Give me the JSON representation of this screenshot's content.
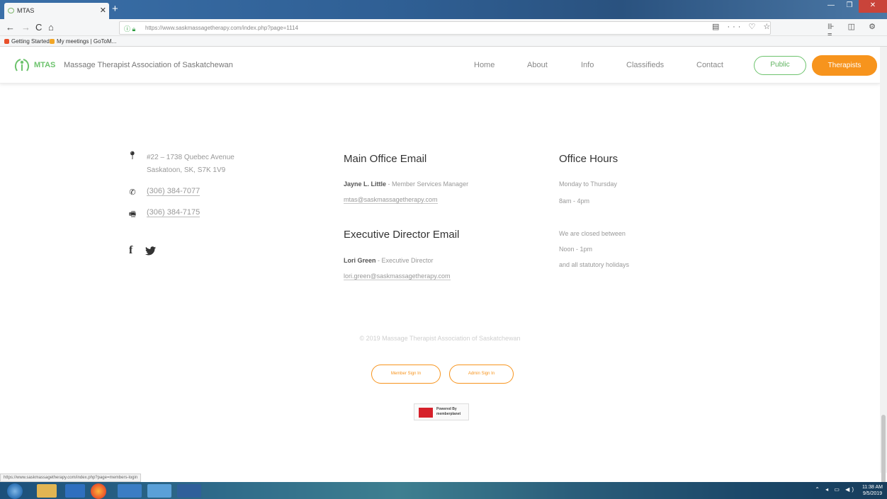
{
  "browser": {
    "tab_title": "MTAS",
    "new_tab_symbol": "+",
    "url": "https://www.saskmassagetherapy.com/index.php?page=1114",
    "nav_back": "←",
    "nav_forward": "→",
    "nav_reload": "C",
    "nav_home": "⌂",
    "page_actions": "▤ ··· ♡ ☆",
    "toolbar_right": "⊪ ◫ ⚙ ≡",
    "bookmarks": [
      "Getting Started",
      "My meetings | GoToM..."
    ],
    "window_controls": [
      "—",
      "❐",
      "✕"
    ]
  },
  "site": {
    "logo_abbr": "MTAS",
    "logo_name": "Massage Therapist Association of Saskatchewan",
    "nav": [
      "Home",
      "About",
      "Info",
      "Classifieds",
      "Contact"
    ],
    "btn_public": "Public",
    "btn_therapists": "Therapists"
  },
  "contact": {
    "address_line1": "#22 – 1738 Quebec Avenue",
    "address_line2": "Saskatoon, SK, S7K 1V9",
    "phone": "(306) 384-7077",
    "fax": "(306) 384-7175"
  },
  "main_office": {
    "heading": "Main Office Email",
    "person_name": "Jayne L. Little",
    "person_role": " - Member Services Manager",
    "email": "mtas@saskmassagetherapy.com"
  },
  "exec_director": {
    "heading": "Executive Director Email",
    "person_name": "Lori Green",
    "person_role": " - Executive Director",
    "email": "lori.green@saskmassagetherapy.com"
  },
  "office_hours": {
    "heading": "Office Hours",
    "days": "Monday to Thursday",
    "hours": "8am - 4pm",
    "closed_line1": "We are closed between",
    "closed_line2": "Noon - 1pm",
    "closed_line3": "and all statutory holidays"
  },
  "footer": {
    "copyright": "© 2019 Massage Therapist Association of Saskatchewan",
    "member_signin": "Member Sign In",
    "admin_signin": "Admin Sign In",
    "powered_line1": "Powered By",
    "powered_line2": "memberplanet"
  },
  "status_url": "https://www.saskmassagetherapy.com/index.php?page=members-login",
  "taskbar": {
    "tray": "⌃ ◂ ▭ ◀)",
    "time": "11:38 AM",
    "date": "9/5/2019"
  },
  "colors": {
    "brand_green": "#6dc36d",
    "brand_orange": "#f7941d"
  }
}
